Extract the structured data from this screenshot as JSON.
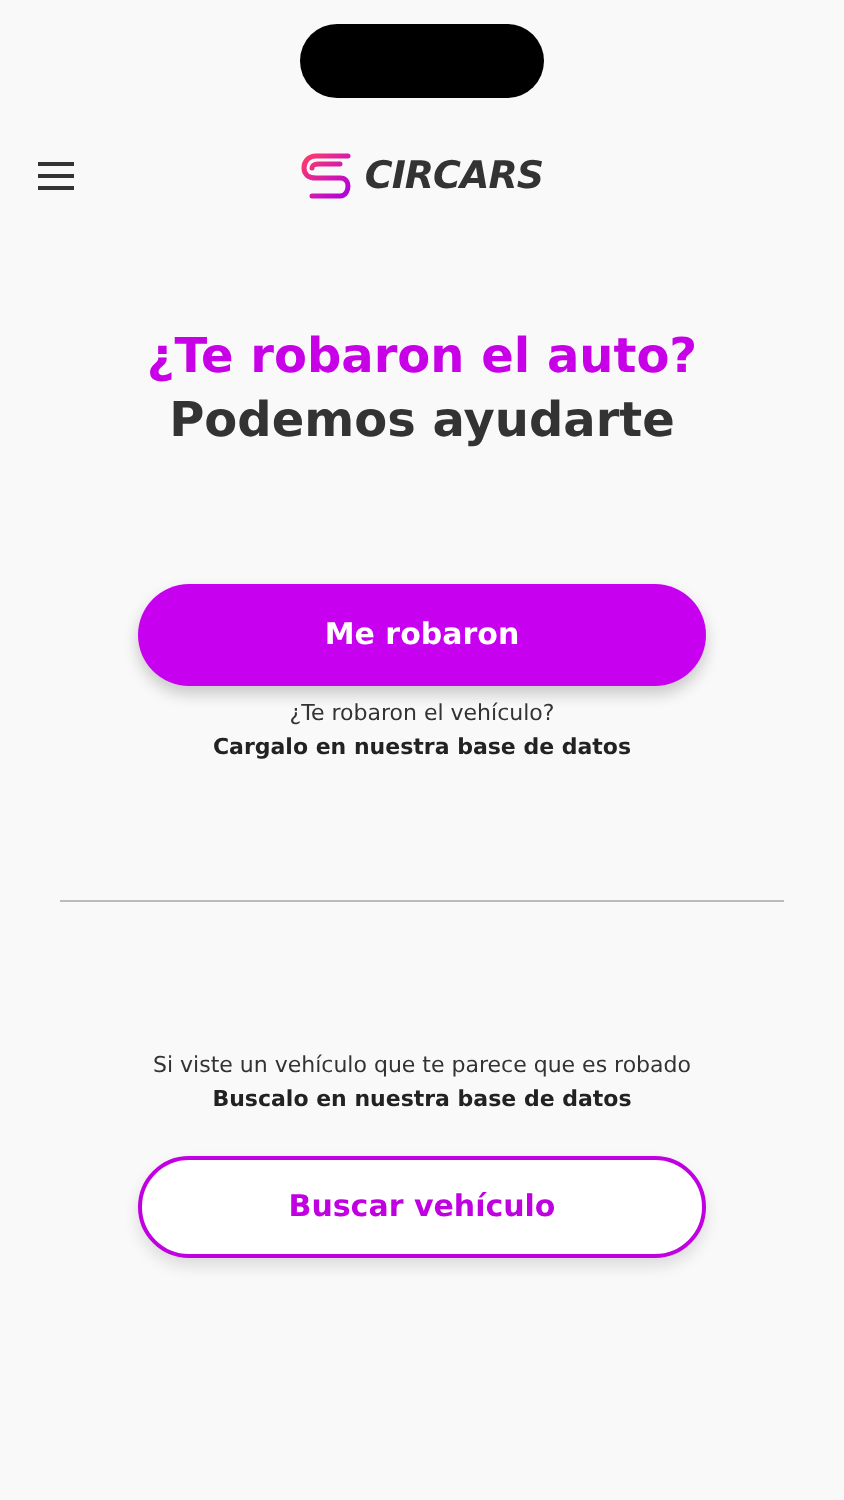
{
  "header": {
    "logo_text": "CIRCARS"
  },
  "headline": {
    "line_1": "¿Te robaron el auto?",
    "line_2": "Podemos ayudarte"
  },
  "report_section": {
    "button": "Me robaron",
    "question": "¿Te robaron el vehículo?",
    "hint": "Cargalo en nuestra base de datos"
  },
  "search_section": {
    "question": "Si viste un vehículo que te parece que es robado",
    "hint": "Buscalo en nuestra base de datos",
    "button": "Buscar vehículo"
  }
}
